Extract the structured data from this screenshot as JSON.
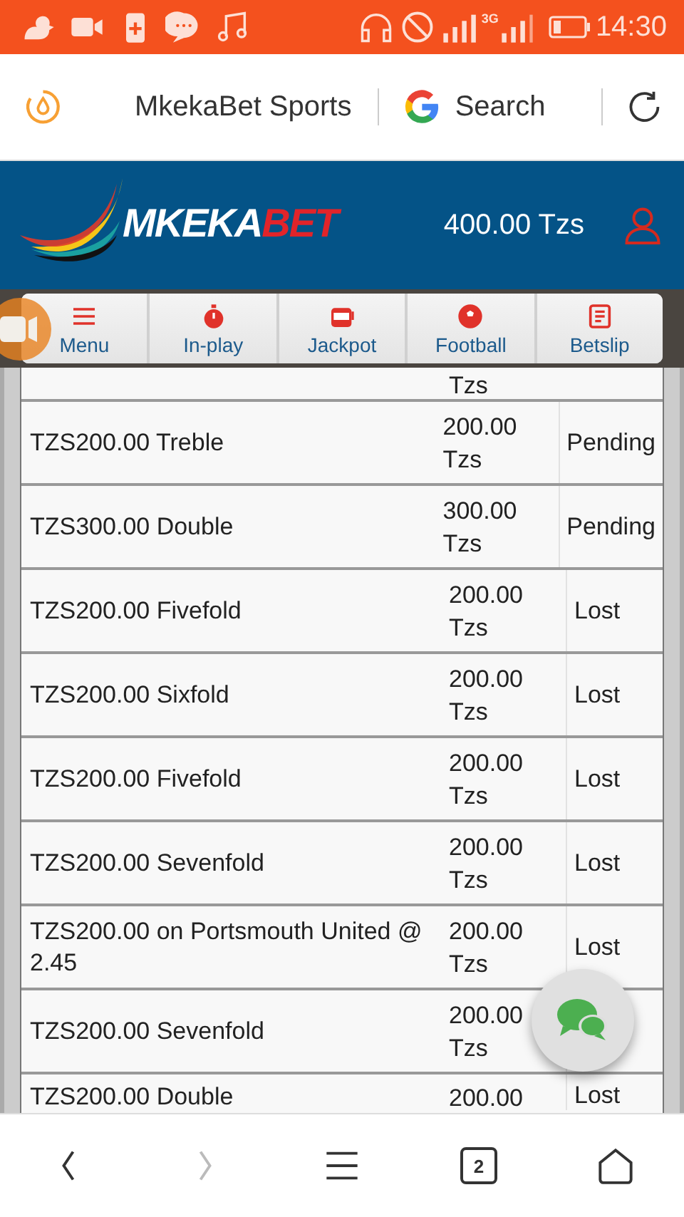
{
  "status_bar": {
    "network_label": "3G",
    "time": "14:30"
  },
  "browser_bar": {
    "title": "MkekaBet Sports",
    "search_label": "Search"
  },
  "header": {
    "logo_white": "MKEKA",
    "logo_red": "BET",
    "balance": "400.00 Tzs"
  },
  "nav": [
    {
      "label": "Menu"
    },
    {
      "label": "In-play"
    },
    {
      "label": "Jackpot"
    },
    {
      "label": "Football"
    },
    {
      "label": "Betslip"
    }
  ],
  "bets": [
    {
      "kind": "cut_top",
      "amount": "Tzs"
    },
    {
      "kind": "full",
      "description": "TZS200.00 Treble",
      "amount": "200.00 Tzs",
      "status": "Pending"
    },
    {
      "kind": "full",
      "description": "TZS300.00 Double",
      "amount": "300.00 Tzs",
      "status": "Pending"
    },
    {
      "kind": "full",
      "description": "TZS200.00 Fivefold",
      "amount": "200.00 Tzs",
      "status": "Lost"
    },
    {
      "kind": "full",
      "description": "TZS200.00 Sixfold",
      "amount": "200.00 Tzs",
      "status": "Lost"
    },
    {
      "kind": "full",
      "description": "TZS200.00 Fivefold",
      "amount": "200.00 Tzs",
      "status": "Lost"
    },
    {
      "kind": "full",
      "description": "TZS200.00 Sevenfold",
      "amount": "200.00 Tzs",
      "status": "Lost"
    },
    {
      "kind": "full",
      "description": "TZS200.00 on Portsmouth United @ 2.45",
      "amount": "200.00 Tzs",
      "status": "Lost"
    },
    {
      "kind": "full",
      "description": "TZS200.00 Sevenfold",
      "amount": "200.00 Tzs"
    },
    {
      "kind": "cut_bottom",
      "description": "TZS200.00 Double",
      "amount": "200.00",
      "status": "Lost"
    }
  ],
  "bottom_nav": {
    "tab_count": "2"
  }
}
